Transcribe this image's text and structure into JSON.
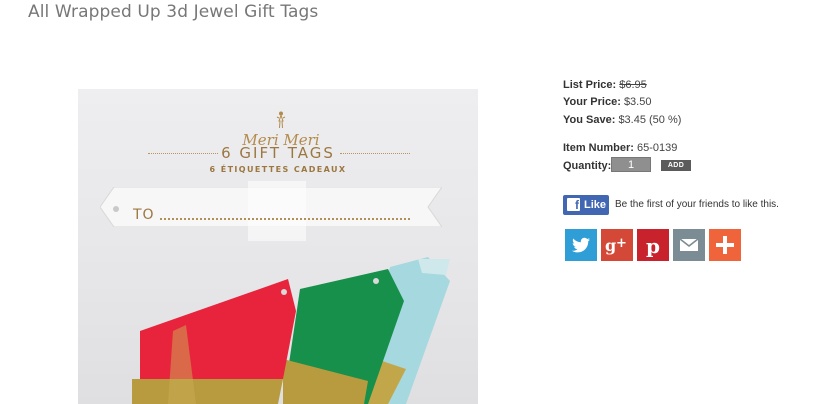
{
  "page": {
    "title": "All Wrapped Up 3d Jewel Gift Tags"
  },
  "product_image": {
    "brand": "Meri  Meri",
    "package_title": "6 GIFT TAGS",
    "package_subtitle": "6 ÉTIQUETTES CADEAUX",
    "tag_text": "TO"
  },
  "pricing": {
    "list_price_label": "List Price:",
    "list_price": "$6.95",
    "your_price_label": "Your Price:",
    "your_price": "$3.50",
    "you_save_label": "You Save:",
    "you_save": "$3.45 (50 %)",
    "item_number_label": "Item Number:",
    "item_number": "65-0139",
    "quantity_label": "Quantity:",
    "quantity_value": "1",
    "add_label": "ADD"
  },
  "social": {
    "like_label": "Like",
    "like_text": "Be the first of your friends to like this.",
    "share_icons": [
      "twitter-icon",
      "google-plus-icon",
      "pinterest-icon",
      "email-icon",
      "plus-icon"
    ]
  },
  "colors": {
    "twitter": "#2f9ed6",
    "google_plus": "#d34836",
    "pinterest": "#c8232c",
    "email": "#7b8c94",
    "plus": "#f0643b",
    "facebook": "#4267b2",
    "tag_red": "#e8243c",
    "tag_green": "#16904a",
    "tag_blue": "#a6d8df",
    "glitter_gold": "#b89b3e"
  }
}
